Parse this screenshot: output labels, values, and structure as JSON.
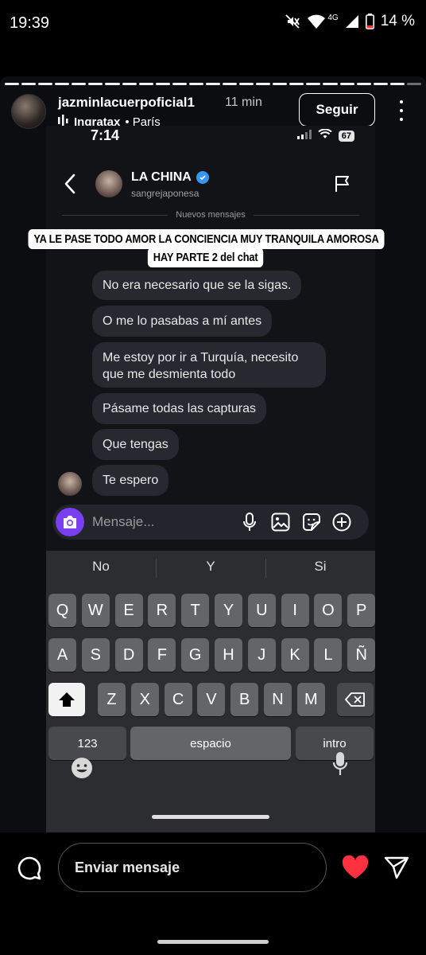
{
  "status_bar": {
    "time": "19:39",
    "network": "4G",
    "battery": "14 %",
    "icons": [
      "mute-icon",
      "wifi-icon",
      "signal-icon",
      "battery-icon"
    ]
  },
  "story": {
    "username": "jazminlacuerpoficial1",
    "time_ago": "11 min",
    "music_artist": "Ingratax",
    "location": "• París",
    "follow_label": "Seguir",
    "caption_line1": "YA LE PASE TODO AMOR LA CONCIENCIA MUY TRANQUILA AMOROSA",
    "caption_line2": "HAY PARTE 2 del chat",
    "segments_total": 25,
    "segments_viewed": 24
  },
  "screenshot": {
    "time": "7:14",
    "battery": "67",
    "chat": {
      "name": "LA CHINA",
      "handle": "sangrejaponesa",
      "new_messages": "Nuevos mensajes",
      "messages": [
        "No era necesario que se la sigas.",
        "O me lo pasabas a mí antes",
        "Me estoy por ir a Turquía, necesito que me desmienta todo",
        "Pásame todas las capturas",
        "Que tengas",
        "Te espero"
      ],
      "compose_placeholder": "Mensaje..."
    },
    "keyboard": {
      "suggestions": [
        "No",
        "Y",
        "Si"
      ],
      "row1": [
        "Q",
        "W",
        "E",
        "R",
        "T",
        "Y",
        "U",
        "I",
        "O",
        "P"
      ],
      "row2": [
        "A",
        "S",
        "D",
        "F",
        "G",
        "H",
        "J",
        "K",
        "L",
        "Ñ"
      ],
      "row3": [
        "Z",
        "X",
        "C",
        "V",
        "B",
        "N",
        "M"
      ],
      "num_label": "123",
      "space_label": "espacio",
      "return_label": "intro"
    }
  },
  "bottom_bar": {
    "send_placeholder": "Enviar mensaje",
    "like_color": "#ff3040"
  }
}
